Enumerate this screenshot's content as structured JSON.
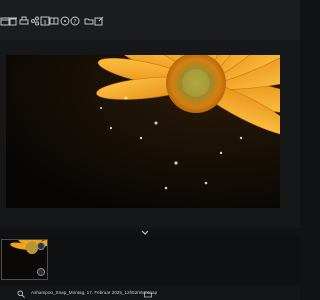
{
  "toolbar": {
    "icons": [
      "window-icon",
      "delete-icon",
      "print-icon",
      "share-icon",
      "info-icon",
      "compare-icon",
      "chat-icon",
      "help-icon",
      "folder-icon",
      "external-icon"
    ]
  },
  "status_bar": {
    "filename": "Ashampoo_Snap_Montag, 17. Februar 2025_12h52m5s.snap"
  },
  "colors": {
    "background": "#111214",
    "toolbar": "#1b1c1f",
    "petal": "#f2a51e"
  }
}
